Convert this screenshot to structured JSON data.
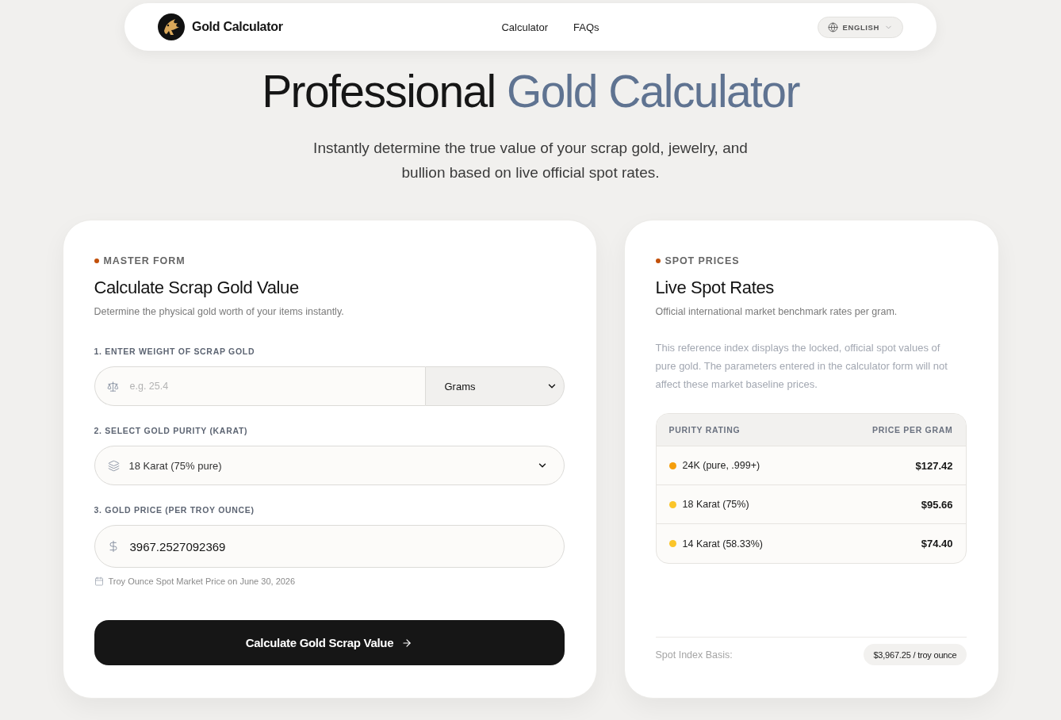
{
  "header": {
    "brand": "Gold Calculator",
    "nav": [
      {
        "label": "Calculator"
      },
      {
        "label": "FAQs"
      }
    ],
    "language": "ENGLISH"
  },
  "hero": {
    "title": "Professional",
    "title_accent": "Gold Calculator",
    "subtitle": "Instantly determine the true value of your scrap gold, jewelry, and bullion based on live official spot rates."
  },
  "calculator": {
    "eyebrow": "MASTER FORM",
    "title": "Calculate Scrap Gold Value",
    "description": "Determine the physical gold worth of your items instantly.",
    "weight": {
      "label": "1. ENTER WEIGHT OF SCRAP GOLD",
      "placeholder": "e.g. 25.4",
      "unit": "Grams"
    },
    "purity": {
      "label": "2. SELECT GOLD PURITY (KARAT)",
      "value": "18 Karat (75% pure)"
    },
    "price": {
      "label": "3. GOLD PRICE (PER TROY OUNCE)",
      "value": "3967.2527092369",
      "hint": "Troy Ounce Spot Market Price on June 30, 2026"
    },
    "button": "Calculate Gold Scrap Value"
  },
  "spot_prices": {
    "eyebrow": "SPOT PRICES",
    "title": "Live Spot Rates",
    "description": "Official international market benchmark rates per gram.",
    "note": "This reference index displays the locked, official spot values of pure gold. The parameters entered in the calculator form will not affect these market baseline prices.",
    "table": {
      "columns": [
        "PURITY RATING",
        "PRICE PER GRAM"
      ],
      "rows": [
        {
          "purity": "24K (pure, .999+)",
          "price": "$127.42",
          "color": "#f59e0b"
        },
        {
          "purity": "18 Karat (75%)",
          "price": "$95.66",
          "color": "#fbc52a"
        },
        {
          "purity": "14 Karat (58.33%)",
          "price": "$74.40",
          "color": "#fbc52a"
        }
      ]
    },
    "footer": {
      "label": "Spot Index Basis:",
      "value": "$3,967.25 / troy ounce"
    }
  }
}
